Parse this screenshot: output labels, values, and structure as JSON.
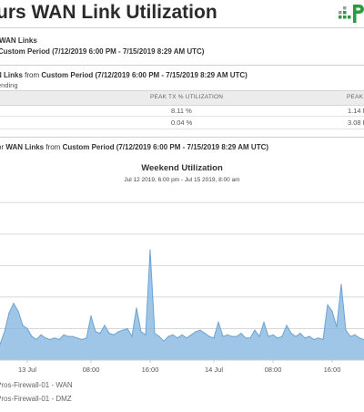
{
  "header": {
    "title": "urs WAN Link Utilization",
    "brand_color": "#2d9a3b"
  },
  "summary": {
    "line1_bold": "WAN Links",
    "line2_bold": "Custom Period (7/12/2019 6:00 PM - 7/15/2019 8:29 AM UTC)"
  },
  "table_section": {
    "heading_bold_a": "N Links",
    "heading_mid": " from ",
    "heading_bold_b": "Custom Period (7/12/2019 6:00 PM - 7/15/2019 8:29 AM UTC)",
    "sub": "ending",
    "columns": [
      "PEAK TX % UTILIZATION",
      "PEAK"
    ],
    "rows": [
      {
        "peak_pct": "8.11 %",
        "peak": "1.14 M"
      },
      {
        "peak_pct": "0.04 %",
        "peak": "3.08 K"
      }
    ]
  },
  "chart_section": {
    "heading_pre": "or ",
    "heading_bold_a": "WAN Links",
    "heading_mid": " from ",
    "heading_bold_b": "Custom Period (7/12/2019 6:00 PM - 7/15/2019 8:29 AM UTC)"
  },
  "chart_data": {
    "type": "area",
    "title": "Weekend Utilization",
    "subtitle": "Jul 12 2019, 6:00 pm - Jul 15 2019, 8:00 am",
    "x_tick_labels": [
      "13 Jul",
      "08:00",
      "16:00",
      "14 Jul",
      "08:00",
      "16:00"
    ],
    "grid": true,
    "legend_position": "bottom-left",
    "series": [
      {
        "name": "Pros-Firewall-01 - WAN",
        "color": "#7fb3de",
        "x": [
          0,
          1,
          2,
          3,
          4,
          5,
          6,
          7,
          8,
          9,
          10,
          11,
          12,
          13,
          14,
          15,
          16,
          17,
          18,
          19,
          20,
          21,
          22,
          23,
          24,
          25,
          26,
          27,
          28,
          29,
          30,
          31,
          32,
          33,
          34,
          35,
          36,
          37,
          38,
          39,
          40,
          41,
          42,
          43,
          44,
          45,
          46,
          47,
          48,
          49,
          50,
          51,
          52,
          53,
          54,
          55,
          56,
          57,
          58,
          59,
          60,
          61,
          62,
          63,
          64,
          65,
          66,
          67,
          68,
          69,
          70,
          71,
          72,
          73,
          74,
          75,
          76,
          77,
          78,
          79,
          80
        ],
        "values": [
          10,
          18,
          30,
          36,
          31,
          22,
          20,
          15,
          13,
          16,
          14,
          13,
          14,
          13,
          16,
          15,
          15,
          14,
          13,
          14,
          28,
          18,
          17,
          22,
          17,
          16,
          18,
          19,
          20,
          15,
          33,
          18,
          16,
          70,
          17,
          15,
          12,
          15,
          16,
          14,
          16,
          14,
          16,
          18,
          19,
          17,
          15,
          14,
          24,
          15,
          16,
          15,
          15,
          17,
          14,
          14,
          19,
          15,
          24,
          15,
          16,
          14,
          15,
          22,
          17,
          15,
          17,
          14,
          15,
          13,
          14,
          13,
          35,
          31,
          21,
          48,
          19,
          15,
          16,
          14,
          13
        ],
        "ylim": [
          0,
          110
        ]
      },
      {
        "name": "Pros-Firewall-01 - DMZ",
        "color": "#5a8f3a",
        "values": []
      }
    ]
  }
}
